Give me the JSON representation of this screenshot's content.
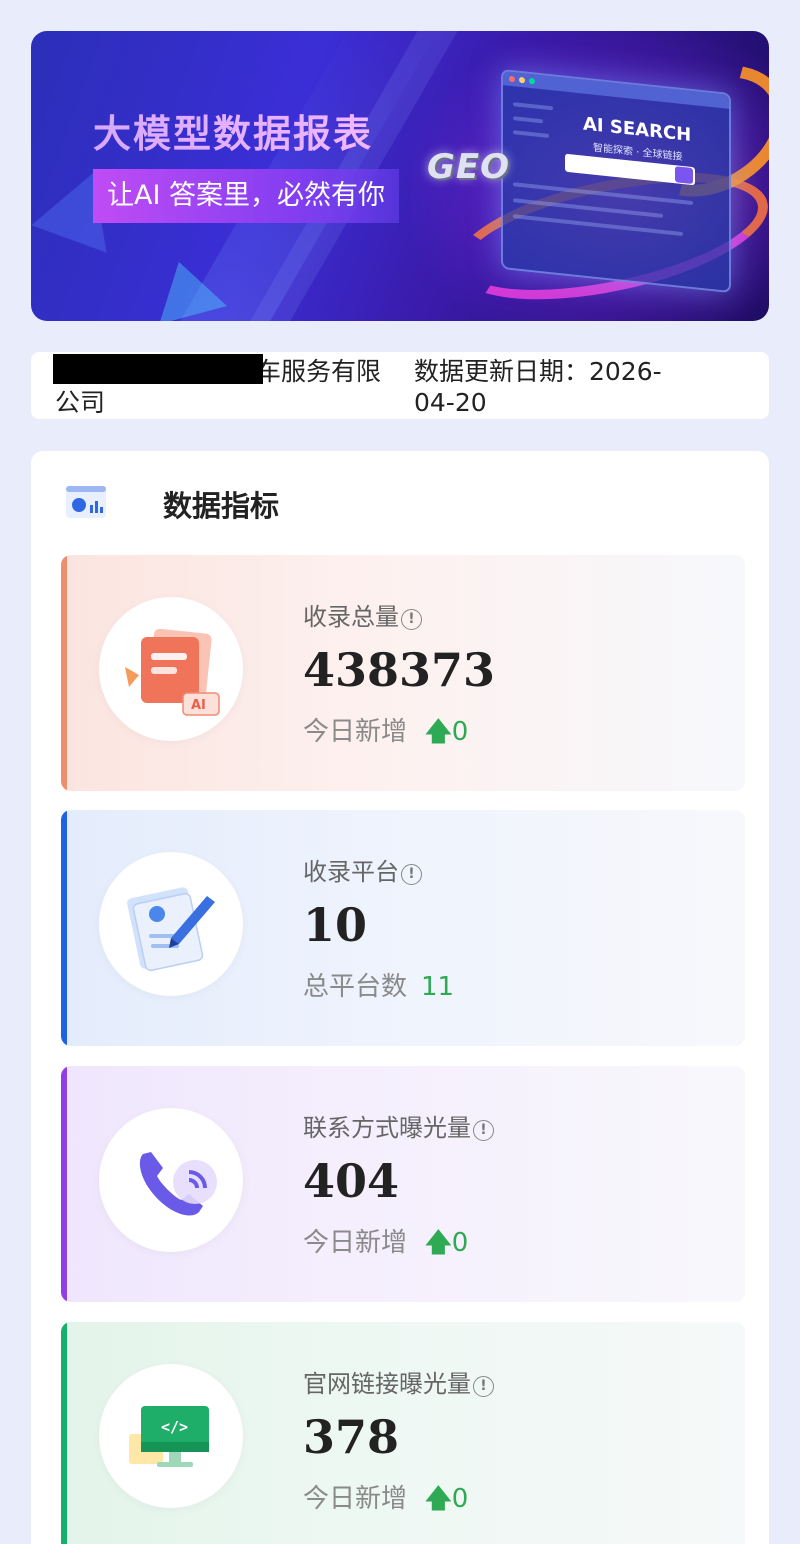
{
  "banner": {
    "title": "大模型数据报表",
    "subtitle": "让AI 答案里，必然有你",
    "geo_logo": "GEO",
    "screen_title": "AI SEARCH",
    "screen_subtitle": "智能探索 · 全球链接"
  },
  "info": {
    "company_line1": "汽车服务有限",
    "company_line2": "公司",
    "date_line1": "数据更新日期：2026-",
    "date_line2": "04-20"
  },
  "panel": {
    "title": "数据指标",
    "cards": [
      {
        "label": "收录总量",
        "value": "438373",
        "sub_label": "今日新增",
        "sub_arrow": "🡅",
        "sub_value": "0",
        "accent": "#ee8f6b",
        "icon": "document-ai-icon"
      },
      {
        "label": "收录平台",
        "value": "10",
        "sub_label": "总平台数",
        "sub_value": "11",
        "accent": "#1f63e2",
        "icon": "edit-document-icon"
      },
      {
        "label": "联系方式曝光量",
        "value": "404",
        "sub_label": "今日新增",
        "sub_arrow": "🡅",
        "sub_value": "0",
        "accent": "#8e3fe6",
        "icon": "phone-call-icon"
      },
      {
        "label": "官网链接曝光量",
        "value": "378",
        "sub_label": "今日新增",
        "sub_arrow": "🡅",
        "sub_value": "0",
        "accent": "#16b06a",
        "icon": "monitor-code-icon"
      }
    ]
  },
  "colors": {
    "background": "#e9ecfb",
    "positive": "#2eaa55"
  }
}
